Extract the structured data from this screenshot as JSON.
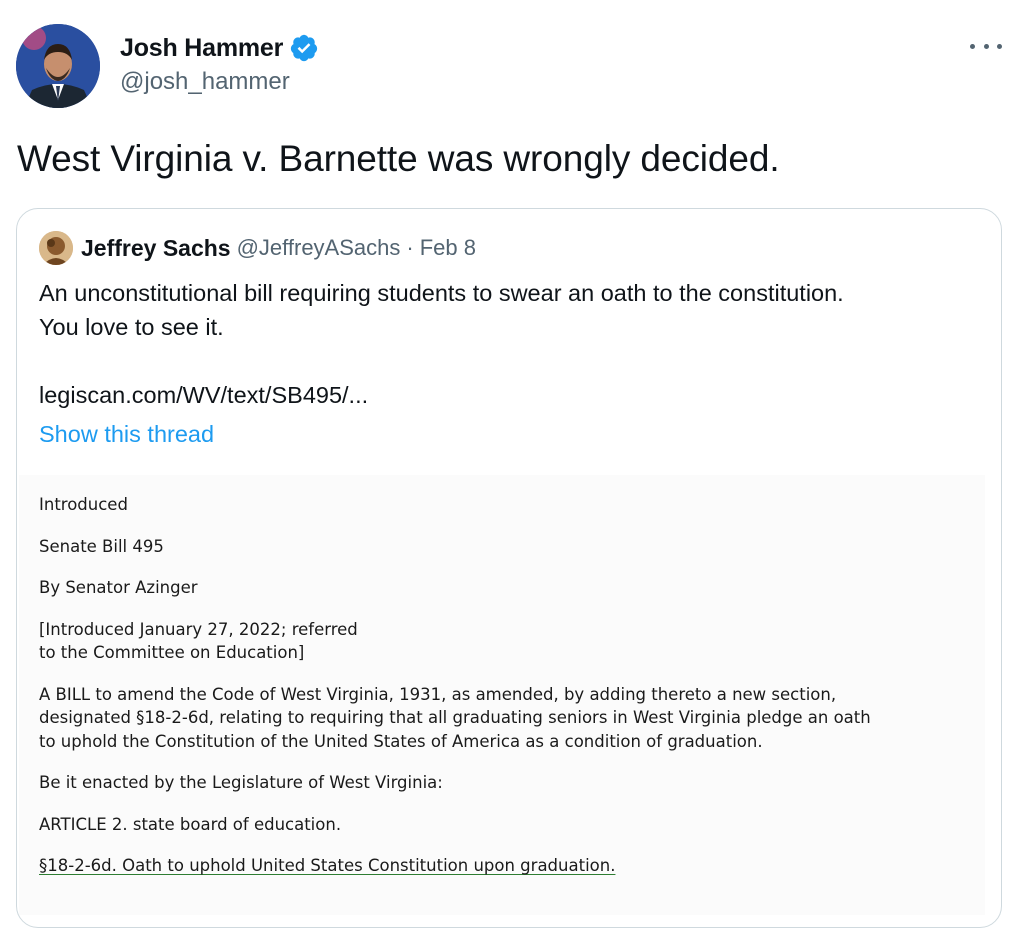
{
  "author": {
    "name": "Josh Hammer",
    "handle": "@josh_hammer",
    "verified_icon": "verified-badge-icon",
    "more_icon": "more-options-icon"
  },
  "tweet": {
    "text": "West Virginia v. Barnette was wrongly decided."
  },
  "quote": {
    "name": "Jeffrey Sachs",
    "handle": "@JeffreyASachs",
    "separator": "·",
    "date": "Feb 8",
    "text_line1": "An unconstitutional bill requiring students to swear an oath to the constitution.",
    "text_line2": "You love to see it.",
    "link": "legiscan.com/WV/text/SB495/...",
    "show_thread": "Show this thread"
  },
  "document": {
    "status": "Introduced",
    "bill": "Senate Bill 495",
    "sponsor": "By Senator Azinger",
    "intro_line1": "[Introduced January 27, 2022; referred",
    "intro_line2": "to the Committee on Education]",
    "summary_line1": "A BILL to amend the Code of West Virginia, 1931, as amended, by adding thereto a new section,",
    "summary_line2": "designated §18-2-6d, relating to requiring that all graduating seniors in West Virginia pledge an oath",
    "summary_line3": "to uphold the Constitution of the United States of America as a condition of graduation.",
    "enacting": "Be it enacted by the Legislature of West Virginia:",
    "article": "ARTICLE 2. state board of education.",
    "section": "§18-2-6d. Oath to uphold United States Constitution upon graduation."
  },
  "colors": {
    "link_blue": "#1d9bf0",
    "secondary_text": "#536471",
    "border": "#cfd9de",
    "section_underline": "#2e7d32"
  }
}
